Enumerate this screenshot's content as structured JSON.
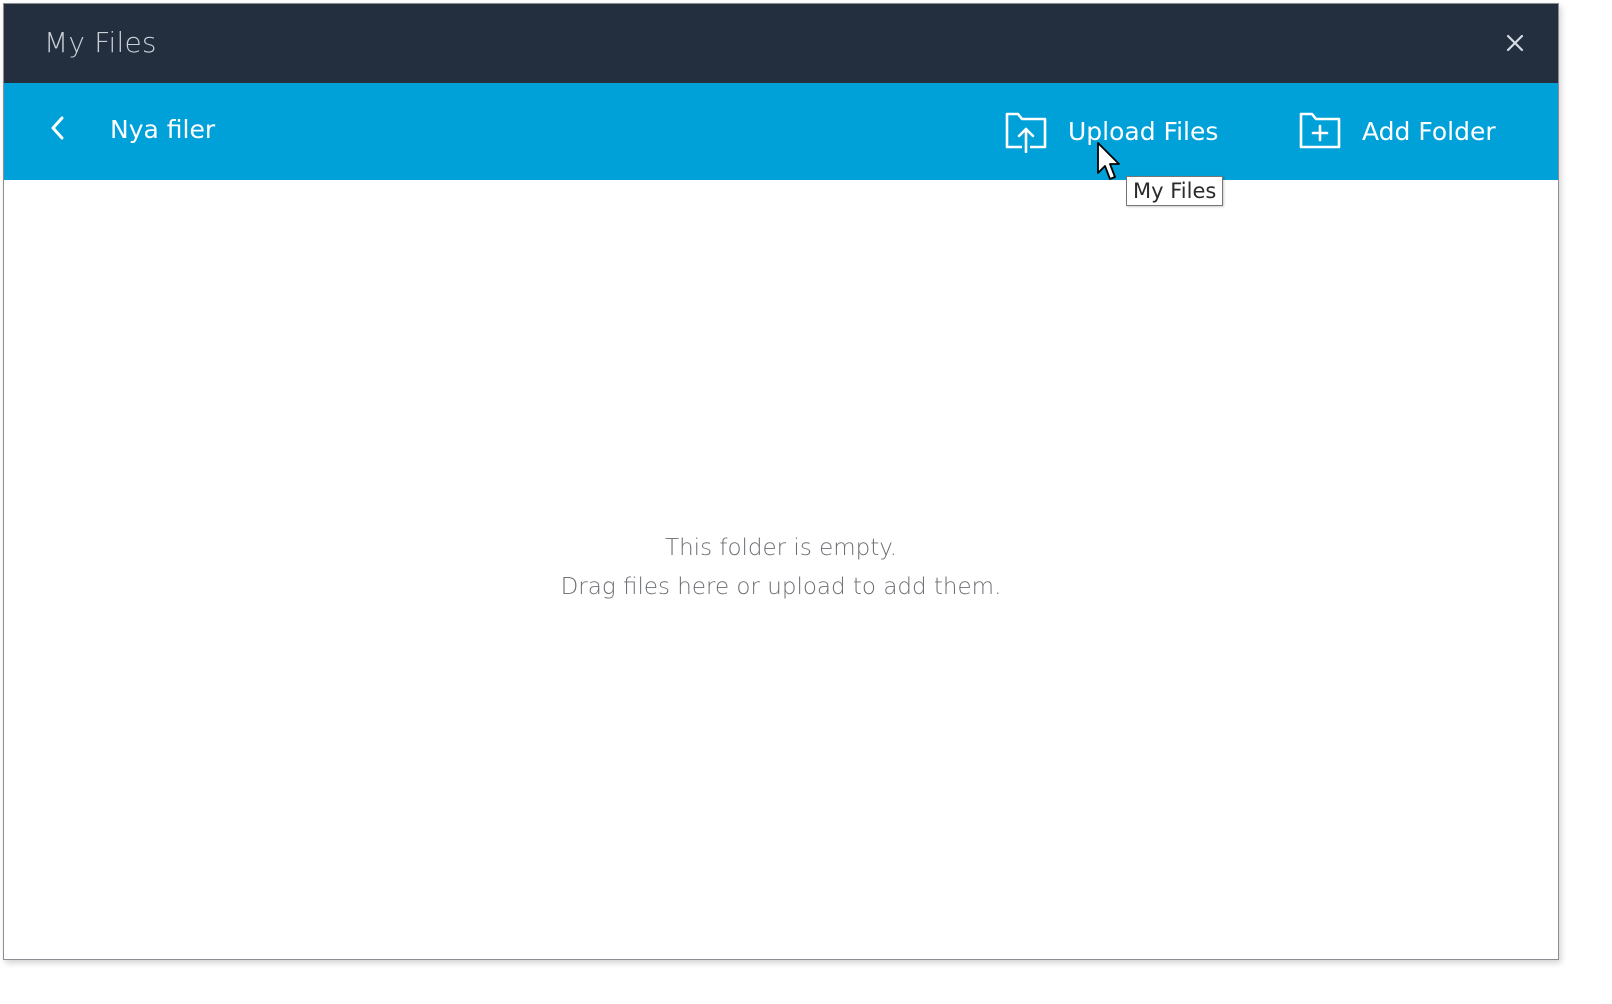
{
  "window": {
    "title": "My Files",
    "close_icon": "close-icon"
  },
  "toolbar": {
    "back_icon": "chevron-left-icon",
    "folder_name": "Nya filer",
    "upload": {
      "label": "Upload Files",
      "icon": "upload-folder-icon"
    },
    "add_folder": {
      "label": "Add Folder",
      "icon": "add-folder-icon"
    }
  },
  "content": {
    "empty_line1": "This folder is empty.",
    "empty_line2": "Drag files here or upload to add them."
  },
  "tooltip": {
    "text": "My Files"
  },
  "colors": {
    "titlebar": "#232f3e",
    "toolbar": "#00a0d9",
    "title_text": "#c9d0d8",
    "empty_text": "#6b6e73"
  }
}
